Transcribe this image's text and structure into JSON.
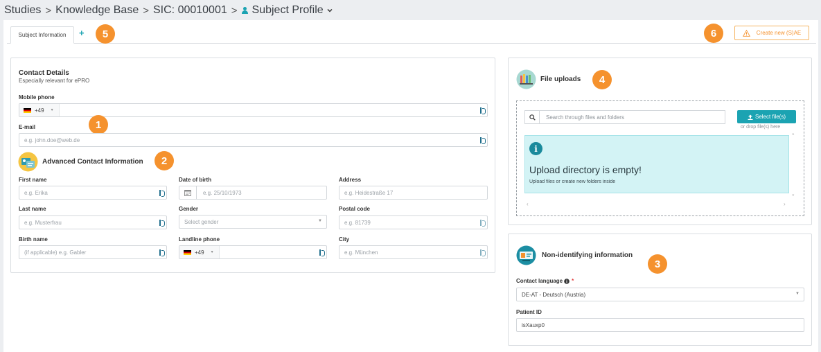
{
  "breadcrumb": {
    "items": [
      "Studies",
      "Knowledge Base",
      "SIC: 00010001"
    ],
    "separator": ">",
    "current": "Subject Profile"
  },
  "tabs": {
    "active": "Subject Information",
    "add_label": "+"
  },
  "actions": {
    "create_sae": "Create new (S)AE"
  },
  "badges": [
    "1",
    "2",
    "3",
    "4",
    "5",
    "6"
  ],
  "contact": {
    "title": "Contact Details",
    "subtitle": "Especially relevant for ePRO",
    "mobile_label": "Mobile phone",
    "mobile_cc": "+49",
    "email_label": "E-mail",
    "email_placeholder": "e.g. john.doe@web.de"
  },
  "advanced": {
    "title": "Advanced Contact Information",
    "first_name_label": "First name",
    "first_name_placeholder": "e.g. Erika",
    "dob_label": "Date of birth",
    "dob_placeholder": "e.g. 25/10/1973",
    "address_label": "Address",
    "address_placeholder": "e.g. Heidestraße 17",
    "last_name_label": "Last name",
    "last_name_placeholder": "e.g. Musterfrau",
    "gender_label": "Gender",
    "gender_placeholder": "Select gender",
    "postal_label": "Postal code",
    "postal_placeholder": "e.g. 81739",
    "birth_name_label": "Birth name",
    "birth_name_placeholder": "(if applicable) e.g. Gabler",
    "landline_label": "Landline phone",
    "landline_cc": "+49",
    "city_label": "City",
    "city_placeholder": "e.g. München"
  },
  "uploads": {
    "title": "File uploads",
    "search_placeholder": "Search through files and folders",
    "select_button": "Select file(s)",
    "drop_hint": "or drop file(s) here",
    "empty_title": "Upload directory is empty!",
    "empty_text": "Upload files or create new folders inside"
  },
  "nonid": {
    "title": "Non-identifying information",
    "language_label": "Contact language",
    "required_mark": "*",
    "language_value": "DE-AT - Deutsch (Austria)",
    "patient_id_label": "Patient ID",
    "patient_id_value": "isXauxp0"
  },
  "colors": {
    "accent": "#1ba3b2",
    "badge": "#f5922e",
    "warning": "#f5922e"
  }
}
